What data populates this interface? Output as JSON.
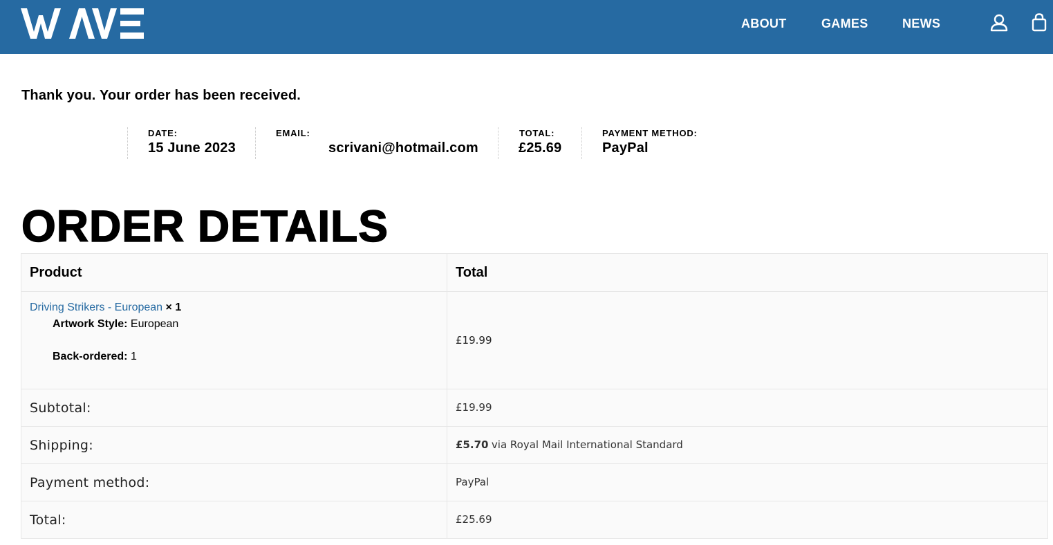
{
  "header": {
    "logo_text": "WAVE",
    "nav": [
      {
        "label": "ABOUT"
      },
      {
        "label": "GAMES"
      },
      {
        "label": "NEWS"
      }
    ],
    "icons": {
      "account": "user-icon",
      "cart": "shopping-bag-icon"
    },
    "background_color": "#266aa2"
  },
  "notice": "Thank you. Your order has been received.",
  "overview": {
    "date_label": "DATE:",
    "date": "15 June 2023",
    "email_label": "EMAIL:",
    "email": "scrivani@hotmail.com",
    "total_label": "TOTAL:",
    "total": "£25.69",
    "payment_label": "PAYMENT METHOD:",
    "payment": "PayPal"
  },
  "order_details": {
    "title": "ORDER DETAILS",
    "columns": [
      "Product",
      "Total"
    ],
    "items": [
      {
        "name": "Driving Strikers - European",
        "qty": "× 1",
        "meta": [
          {
            "key": "Artwork Style:",
            "value": "European"
          },
          {
            "key": "Back-ordered:",
            "value": "1"
          }
        ],
        "total": "£19.99"
      }
    ],
    "totals": {
      "subtotal_label": "Subtotal:",
      "subtotal": "£19.99",
      "shipping_label": "Shipping:",
      "shipping_amount": "£5.70",
      "shipping_via": "via Royal Mail International Standard",
      "payment_label": "Payment method:",
      "payment": "PayPal",
      "total_label": "Total:",
      "total": "£25.69"
    },
    "link_color": "#266aa2"
  }
}
